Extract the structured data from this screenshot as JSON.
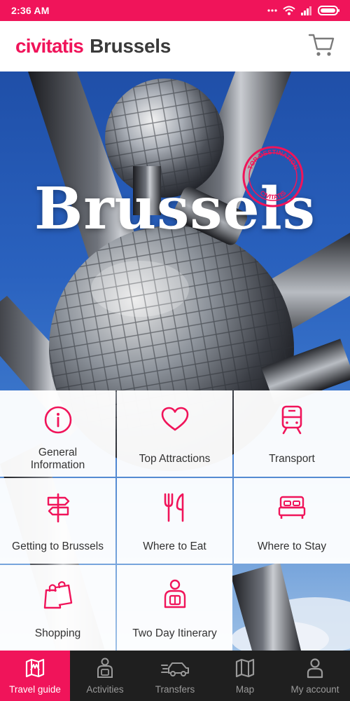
{
  "status_bar": {
    "time": "2:36 AM"
  },
  "header": {
    "logo": "civitatis",
    "city": "Brussels"
  },
  "hero": {
    "title": "Brussels",
    "stamp_text_top": "TOP DESTINATION",
    "stamp_text_bottom": "CIVITATIS"
  },
  "menu": {
    "tiles": [
      {
        "label": "General\nInformation",
        "icon": "info-icon"
      },
      {
        "label": "Top Attractions",
        "icon": "heart-icon"
      },
      {
        "label": "Transport",
        "icon": "train-icon"
      },
      {
        "label": "Getting to Brussels",
        "icon": "signpost-icon"
      },
      {
        "label": "Where to Eat",
        "icon": "cutlery-icon"
      },
      {
        "label": "Where to Stay",
        "icon": "bed-icon"
      },
      {
        "label": "Shopping",
        "icon": "shopping-bags-icon"
      },
      {
        "label": "Two Day Itinerary",
        "icon": "traveler-icon"
      }
    ]
  },
  "bottom_nav": {
    "items": [
      {
        "label": "Travel guide",
        "icon": "map-guide-icon",
        "active": true
      },
      {
        "label": "Activities",
        "icon": "traveler-icon",
        "active": false
      },
      {
        "label": "Transfers",
        "icon": "car-icon",
        "active": false
      },
      {
        "label": "Map",
        "icon": "map-icon",
        "active": false
      },
      {
        "label": "My account",
        "icon": "user-icon",
        "active": false
      }
    ]
  },
  "colors": {
    "accent": "#f0145a",
    "nav_bg": "#1f1f1f",
    "nav_inactive": "#9a9a9a",
    "text": "#333333"
  }
}
